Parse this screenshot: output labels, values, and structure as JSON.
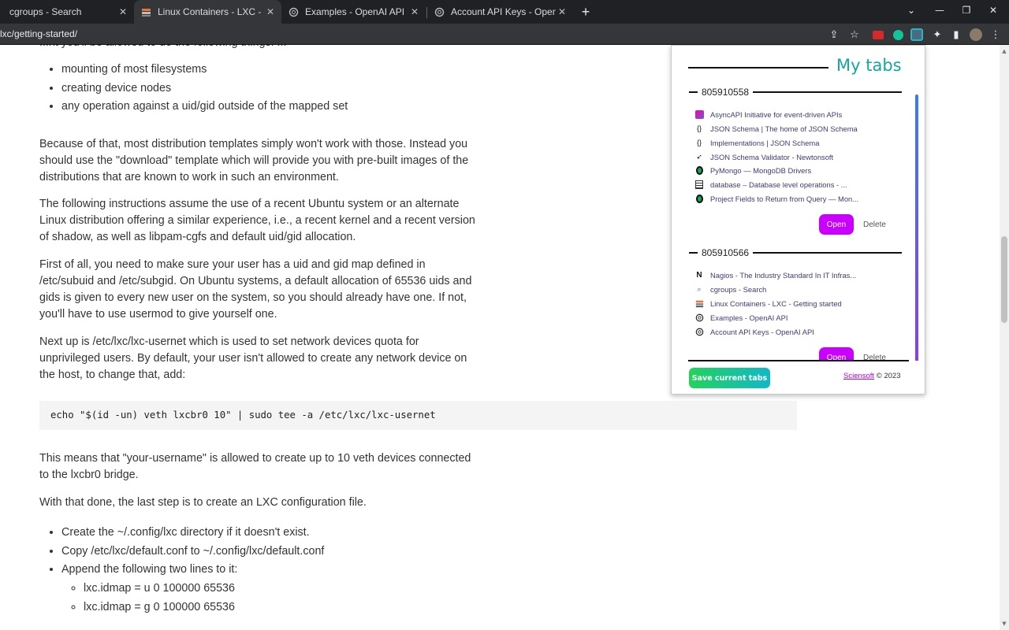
{
  "tabs": [
    {
      "title": "cgroups - Search",
      "icon": "search-icon",
      "active": false
    },
    {
      "title": "Linux Containers - LXC - Getting",
      "icon": "lxc-icon",
      "active": true
    },
    {
      "title": "Examples - OpenAI API",
      "icon": "openai-icon",
      "active": false
    },
    {
      "title": "Account API Keys - OpenAI API",
      "icon": "openai-icon",
      "active": false
    }
  ],
  "toolbar": {
    "url": "lxc/getting-started/"
  },
  "article": {
    "cutoff_text": "...nt you'll be allowed to do the following things: ...",
    "bullets_top": [
      "mounting of most filesystems",
      "creating device nodes",
      "any operation against a uid/gid outside of the mapped set"
    ],
    "p1": "Because of that, most distribution templates simply won't work with those. Instead you should use the \"download\" template which will provide you with pre-built images of the distributions that are known to work in such an environment.",
    "p2": "The following instructions assume the use of a recent Ubuntu system or an alternate Linux distribution offering a similar experience, i.e., a recent kernel and a recent version of shadow, as well as libpam-cgfs and default uid/gid allocation.",
    "p3": "First of all, you need to make sure your user has a uid and gid map defined in /etc/subuid and /etc/subgid. On Ubuntu systems, a default allocation of 65536 uids and gids is given to every new user on the system, so you should already have one. If not, you'll have to use usermod to give yourself one.",
    "p4": "Next up is /etc/lxc/lxc-usernet which is used to set network devices quota for unprivileged users. By default, your user isn't allowed to create any network device on the host, to change that, add:",
    "code": "echo \"$(id -un) veth lxcbr0 10\" | sudo tee -a /etc/lxc/lxc-usernet",
    "p5": "This means that \"your-username\" is allowed to create up to 10 veth devices connected to the lxcbr0 bridge.",
    "p6": "With that done, the last step is to create an LXC configuration file.",
    "bullets_bottom": [
      "Create the ~/.config/lxc directory if it doesn't exist.",
      "Copy /etc/lxc/default.conf to ~/.config/lxc/default.conf",
      "Append the following two lines to it:"
    ],
    "sub_bullets": [
      "lxc.idmap = u 0 100000 65536",
      "lxc.idmap = g 0 100000 65536"
    ]
  },
  "popup": {
    "title": "My tabs",
    "groups": [
      {
        "name": "805910558",
        "items": [
          {
            "title": "AsyncAPI Initiative for event-driven APIs",
            "icon": "asyncapi-icon"
          },
          {
            "title": "JSON Schema | The home of JSON Schema",
            "icon": "json-schema-icon"
          },
          {
            "title": "Implementations | JSON Schema",
            "icon": "json-schema-icon"
          },
          {
            "title": "JSON Schema Validator - Newtonsoft",
            "icon": "rocket-icon"
          },
          {
            "title": "PyMongo — MongoDB Drivers",
            "icon": "mongodb-leaf-icon"
          },
          {
            "title": "database – Database level operations - ...",
            "icon": "docs-icon"
          },
          {
            "title": "Project Fields to Return from Query — Mon...",
            "icon": "mongodb-leaf-icon"
          }
        ],
        "open_label": "Open",
        "delete_label": "Delete"
      },
      {
        "name": "805910566",
        "items": [
          {
            "title": "Nagios - The Industry Standard In IT Infras...",
            "icon": "nagios-icon"
          },
          {
            "title": "cgroups - Search",
            "icon": "search-icon"
          },
          {
            "title": "Linux Containers - LXC - Getting started",
            "icon": "lxc-icon"
          },
          {
            "title": "Examples - OpenAI API",
            "icon": "openai-icon"
          },
          {
            "title": "Account API Keys - OpenAI API",
            "icon": "openai-icon"
          }
        ],
        "open_label": "Open",
        "delete_label": "Delete"
      }
    ],
    "save_label": "Save current tabs",
    "credit_link": "Sciensoft",
    "credit_suffix": "© 2023"
  },
  "colors": {
    "accent_title": "#14a6a0",
    "open_button": "#c900ff",
    "save_gradient_start": "#22d35a",
    "save_gradient_end": "#12b8c8"
  }
}
